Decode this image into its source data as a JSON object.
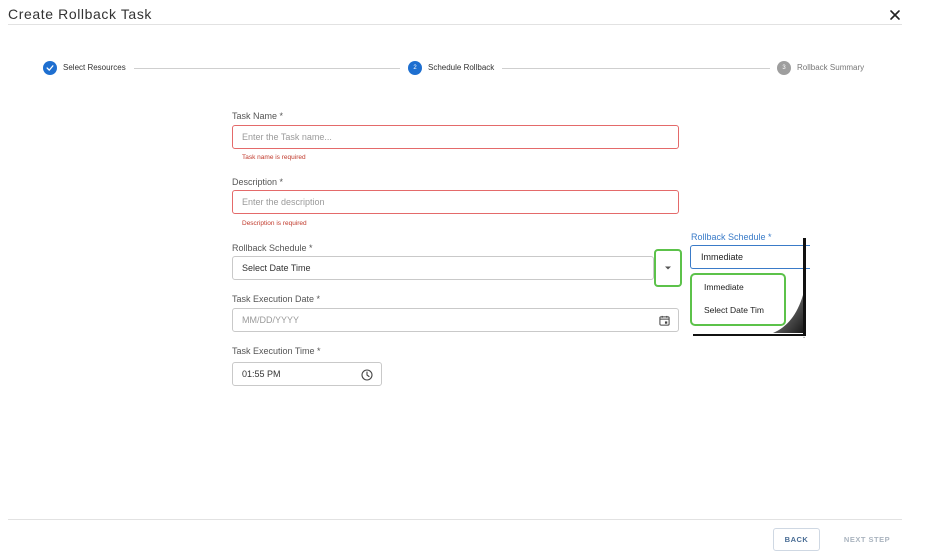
{
  "dialog": {
    "title": "Create Rollback Task"
  },
  "stepper": {
    "steps": [
      {
        "number": "1",
        "label": "Select Resources",
        "state": "complete"
      },
      {
        "number": "2",
        "label": "Schedule Rollback",
        "state": "active"
      },
      {
        "number": "3",
        "label": "Rollback Summary",
        "state": "pending"
      }
    ]
  },
  "form": {
    "task_name": {
      "label": "Task Name *",
      "placeholder": "Enter the Task name...",
      "error": "Task name is required"
    },
    "description": {
      "label": "Description *",
      "placeholder": "Enter the description",
      "error": "Description is required"
    },
    "rollback_schedule": {
      "label": "Rollback Schedule *",
      "value": "Select Date Time"
    },
    "execution_date": {
      "label": "Task Execution Date *",
      "placeholder": "MM/DD/YYYY"
    },
    "execution_time": {
      "label": "Task Execution Time *",
      "value": "01:55 PM"
    }
  },
  "callout": {
    "label": "Rollback Schedule *",
    "value": "Immediate",
    "options": [
      "Immediate",
      "Select Date Tim"
    ]
  },
  "footer": {
    "back_label": "BACK",
    "next_label": "NEXT STEP"
  },
  "colors": {
    "accent": "#1e6fd0",
    "error": "#c0392b",
    "highlight": "#5cc24a",
    "pending": "#9e9e9e"
  }
}
